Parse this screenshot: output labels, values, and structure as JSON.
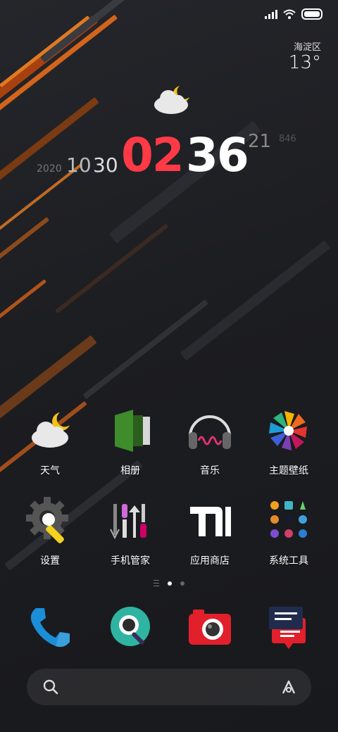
{
  "status_bar": {
    "icons": [
      "signal-icon",
      "wifi-icon",
      "battery-icon"
    ]
  },
  "weather": {
    "city": "海淀区",
    "temperature": "13°",
    "icon": "partly-cloudy-night-icon"
  },
  "clock": {
    "year": "2020",
    "month": "10",
    "day": "30",
    "hour": "02",
    "minute": "36",
    "second": "21",
    "millis": "846"
  },
  "apps": [
    {
      "label": "天气",
      "icon": "weather-icon"
    },
    {
      "label": "相册",
      "icon": "gallery-icon"
    },
    {
      "label": "音乐",
      "icon": "music-icon"
    },
    {
      "label": "主题壁纸",
      "icon": "themes-icon"
    },
    {
      "label": "设置",
      "icon": "settings-icon"
    },
    {
      "label": "手机管家",
      "icon": "security-icon"
    },
    {
      "label": "应用商店",
      "icon": "app-store-icon"
    },
    {
      "label": "系统工具",
      "icon": "tools-folder-icon"
    }
  ],
  "page_indicator": {
    "pages": 2,
    "current": 1
  },
  "dock": [
    {
      "icon": "phone-icon"
    },
    {
      "icon": "browser-icon"
    },
    {
      "icon": "camera-icon"
    },
    {
      "icon": "messages-icon"
    }
  ],
  "search": {
    "icons": [
      "search-icon",
      "assistant-icon"
    ]
  },
  "colors": {
    "accent_red": "#ff3a47",
    "background": "#1f2024"
  }
}
